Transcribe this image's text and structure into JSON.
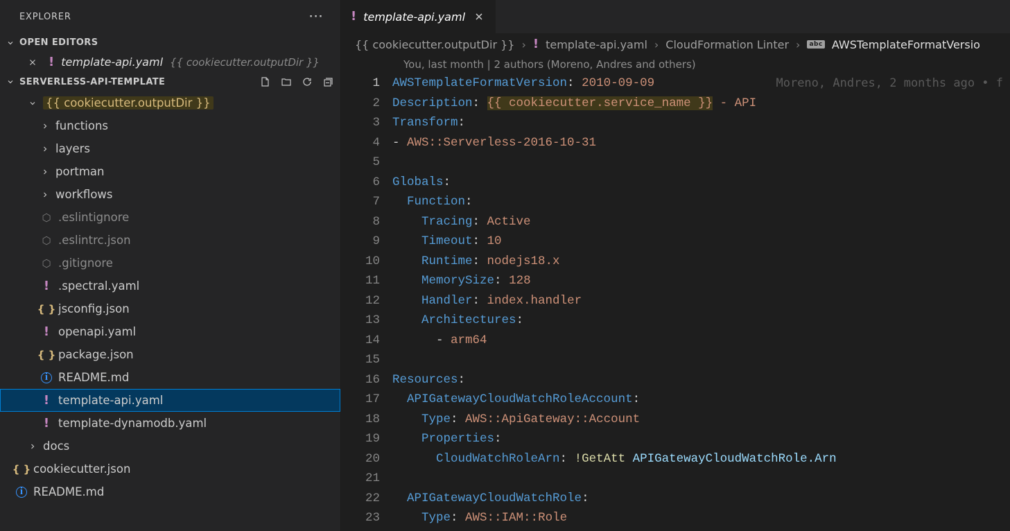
{
  "explorer": {
    "title": "EXPLORER",
    "openEditorsLabel": "OPEN EDITORS",
    "workspaceName": "SERVERLESS-API-TEMPLATE",
    "openEditor": {
      "name": "template-api.yaml",
      "path": "{{ cookiecutter.outputDir }}"
    },
    "tree": [
      {
        "kind": "folder",
        "depth": 1,
        "expanded": true,
        "name": "{{ cookiecutter.outputDir }}",
        "highlight": true
      },
      {
        "kind": "folder",
        "depth": 2,
        "expanded": false,
        "name": "functions"
      },
      {
        "kind": "folder",
        "depth": 2,
        "expanded": false,
        "name": "layers"
      },
      {
        "kind": "folder",
        "depth": 2,
        "expanded": false,
        "name": "portman"
      },
      {
        "kind": "folder",
        "depth": 2,
        "expanded": false,
        "name": "workflows"
      },
      {
        "kind": "file",
        "depth": 2,
        "icon": "hex",
        "name": ".eslintignore",
        "dim": true
      },
      {
        "kind": "file",
        "depth": 2,
        "icon": "hex",
        "name": ".eslintrc.json",
        "dim": true
      },
      {
        "kind": "file",
        "depth": 2,
        "icon": "hex",
        "name": ".gitignore",
        "dim": true
      },
      {
        "kind": "file",
        "depth": 2,
        "icon": "bang",
        "name": ".spectral.yaml"
      },
      {
        "kind": "file",
        "depth": 2,
        "icon": "brace",
        "name": "jsconfig.json"
      },
      {
        "kind": "file",
        "depth": 2,
        "icon": "bang",
        "name": "openapi.yaml"
      },
      {
        "kind": "file",
        "depth": 2,
        "icon": "brace",
        "name": "package.json"
      },
      {
        "kind": "file",
        "depth": 2,
        "icon": "info",
        "name": "README.md"
      },
      {
        "kind": "file",
        "depth": 2,
        "icon": "bang",
        "name": "template-api.yaml",
        "selected": true
      },
      {
        "kind": "file",
        "depth": 2,
        "icon": "bang",
        "name": "template-dynamodb.yaml"
      },
      {
        "kind": "folder",
        "depth": 1,
        "expanded": false,
        "name": "docs"
      },
      {
        "kind": "file",
        "depth": 0,
        "icon": "brace",
        "name": "cookiecutter.json"
      },
      {
        "kind": "file",
        "depth": 0,
        "icon": "info",
        "name": "README.md"
      }
    ]
  },
  "editor": {
    "tab": {
      "name": "template-api.yaml"
    },
    "breadcrumbs": {
      "p1": "{{ cookiecutter.outputDir }}",
      "p2": "template-api.yaml",
      "p3": "CloudFormation Linter",
      "p4": "AWSTemplateFormatVersio"
    },
    "codelens": "You, last month | 2 authors (Moreno, Andres and others)",
    "blame": "Moreno, Andres, 2 months ago • f",
    "lines": [
      [
        {
          "t": "AWSTemplateFormatVersion",
          "c": "key"
        },
        {
          "t": ": ",
          "c": "sep"
        },
        {
          "t": "2010-09-09",
          "c": "str"
        }
      ],
      [
        {
          "t": "Description",
          "c": "key"
        },
        {
          "t": ": ",
          "c": "sep"
        },
        {
          "t": "{{ cookiecutter.service_name }}",
          "c": "str",
          "hl": true
        },
        {
          "t": " - API",
          "c": "str"
        }
      ],
      [
        {
          "t": "Transform",
          "c": "key"
        },
        {
          "t": ":",
          "c": "sep"
        }
      ],
      [
        {
          "t": "- ",
          "c": "plain"
        },
        {
          "t": "AWS::Serverless-2016-10-31",
          "c": "str"
        }
      ],
      [],
      [
        {
          "t": "Globals",
          "c": "key"
        },
        {
          "t": ":",
          "c": "sep"
        }
      ],
      [
        {
          "t": "  ",
          "c": "plain"
        },
        {
          "t": "Function",
          "c": "key"
        },
        {
          "t": ":",
          "c": "sep"
        }
      ],
      [
        {
          "t": "    ",
          "c": "plain"
        },
        {
          "t": "Tracing",
          "c": "key"
        },
        {
          "t": ": ",
          "c": "sep"
        },
        {
          "t": "Active",
          "c": "str"
        }
      ],
      [
        {
          "t": "    ",
          "c": "plain"
        },
        {
          "t": "Timeout",
          "c": "key"
        },
        {
          "t": ": ",
          "c": "sep"
        },
        {
          "t": "10",
          "c": "str"
        }
      ],
      [
        {
          "t": "    ",
          "c": "plain"
        },
        {
          "t": "Runtime",
          "c": "key"
        },
        {
          "t": ": ",
          "c": "sep"
        },
        {
          "t": "nodejs18.x",
          "c": "str"
        }
      ],
      [
        {
          "t": "    ",
          "c": "plain"
        },
        {
          "t": "MemorySize",
          "c": "key"
        },
        {
          "t": ": ",
          "c": "sep"
        },
        {
          "t": "128",
          "c": "str"
        }
      ],
      [
        {
          "t": "    ",
          "c": "plain"
        },
        {
          "t": "Handler",
          "c": "key"
        },
        {
          "t": ": ",
          "c": "sep"
        },
        {
          "t": "index.handler",
          "c": "str"
        }
      ],
      [
        {
          "t": "    ",
          "c": "plain"
        },
        {
          "t": "Architectures",
          "c": "key"
        },
        {
          "t": ":",
          "c": "sep"
        }
      ],
      [
        {
          "t": "      - ",
          "c": "plain"
        },
        {
          "t": "arm64",
          "c": "str"
        }
      ],
      [],
      [
        {
          "t": "Resources",
          "c": "key"
        },
        {
          "t": ":",
          "c": "sep"
        }
      ],
      [
        {
          "t": "  ",
          "c": "plain"
        },
        {
          "t": "APIGatewayCloudWatchRoleAccount",
          "c": "key"
        },
        {
          "t": ":",
          "c": "sep"
        }
      ],
      [
        {
          "t": "    ",
          "c": "plain"
        },
        {
          "t": "Type",
          "c": "key"
        },
        {
          "t": ": ",
          "c": "sep"
        },
        {
          "t": "AWS::ApiGateway::Account",
          "c": "str"
        }
      ],
      [
        {
          "t": "    ",
          "c": "plain"
        },
        {
          "t": "Properties",
          "c": "key"
        },
        {
          "t": ":",
          "c": "sep"
        }
      ],
      [
        {
          "t": "      ",
          "c": "plain"
        },
        {
          "t": "CloudWatchRoleArn",
          "c": "key"
        },
        {
          "t": ": ",
          "c": "sep"
        },
        {
          "t": "!GetAtt",
          "c": "fn"
        },
        {
          "t": " ",
          "c": "plain"
        },
        {
          "t": "APIGatewayCloudWatchRole.Arn",
          "c": "var"
        }
      ],
      [],
      [
        {
          "t": "  ",
          "c": "plain"
        },
        {
          "t": "APIGatewayCloudWatchRole",
          "c": "key"
        },
        {
          "t": ":",
          "c": "sep"
        }
      ],
      [
        {
          "t": "    ",
          "c": "plain"
        },
        {
          "t": "Type",
          "c": "key"
        },
        {
          "t": ": ",
          "c": "sep"
        },
        {
          "t": "AWS::IAM::Role",
          "c": "str"
        }
      ]
    ]
  }
}
